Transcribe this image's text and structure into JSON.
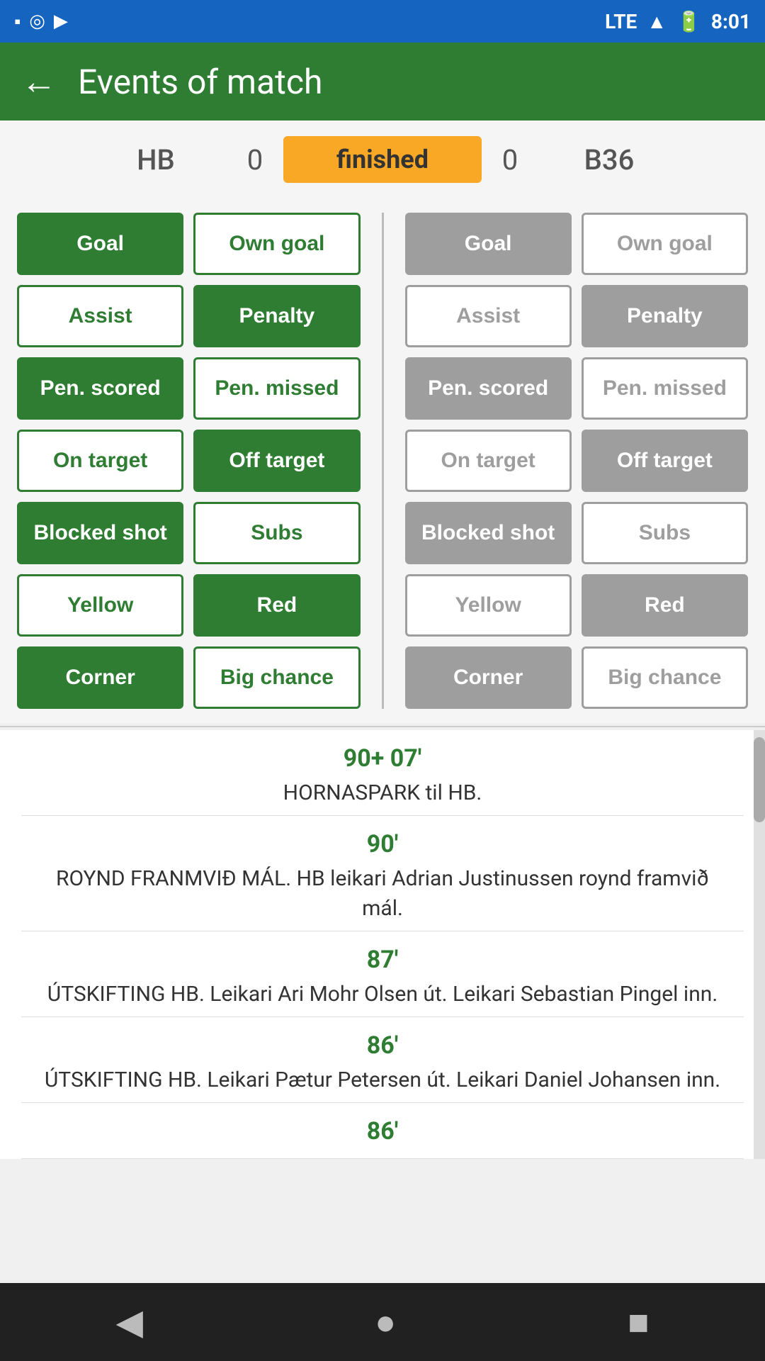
{
  "statusBar": {
    "time": "8:01",
    "icons": [
      "sd-icon",
      "signal-icon",
      "play-icon",
      "lte-icon",
      "battery-icon"
    ]
  },
  "header": {
    "backLabel": "←",
    "title": "Events of match"
  },
  "scoreRow": {
    "homeTeam": "HB",
    "homeScore": "0",
    "status": "finished",
    "awayScore": "0",
    "awayTeam": "B36"
  },
  "homeButtons": [
    {
      "label": "Goal",
      "style": "green-filled"
    },
    {
      "label": "Own goal",
      "style": "green-outline"
    },
    {
      "label": "Assist",
      "style": "green-outline"
    },
    {
      "label": "Penalty",
      "style": "green-filled"
    },
    {
      "label": "Pen. scored",
      "style": "green-filled"
    },
    {
      "label": "Pen. missed",
      "style": "green-outline"
    },
    {
      "label": "On target",
      "style": "green-outline"
    },
    {
      "label": "Off target",
      "style": "green-filled"
    },
    {
      "label": "Blocked shot",
      "style": "green-filled"
    },
    {
      "label": "Subs",
      "style": "green-outline"
    },
    {
      "label": "Yellow",
      "style": "green-outline"
    },
    {
      "label": "Red",
      "style": "green-filled"
    },
    {
      "label": "Corner",
      "style": "green-filled"
    },
    {
      "label": "Big chance",
      "style": "green-outline"
    }
  ],
  "awayButtons": [
    {
      "label": "Goal",
      "style": "gray-filled"
    },
    {
      "label": "Own goal",
      "style": "gray-outline"
    },
    {
      "label": "Assist",
      "style": "gray-outline"
    },
    {
      "label": "Penalty",
      "style": "gray-filled"
    },
    {
      "label": "Pen. scored",
      "style": "gray-filled"
    },
    {
      "label": "Pen. missed",
      "style": "gray-outline"
    },
    {
      "label": "On target",
      "style": "gray-outline"
    },
    {
      "label": "Off target",
      "style": "gray-filled"
    },
    {
      "label": "Blocked shot",
      "style": "gray-filled"
    },
    {
      "label": "Subs",
      "style": "gray-outline"
    },
    {
      "label": "Yellow",
      "style": "gray-outline"
    },
    {
      "label": "Red",
      "style": "gray-filled"
    },
    {
      "label": "Corner",
      "style": "gray-filled"
    },
    {
      "label": "Big chance",
      "style": "gray-outline"
    }
  ],
  "events": [
    {
      "time": "90+ 07'",
      "description": "HORNASPARK til HB."
    },
    {
      "time": "90'",
      "description": "ROYND FRANMVIÐ MÁL. HB leikari Adrian Justinussen roynd framvið mál."
    },
    {
      "time": "87'",
      "description": "ÚTSKIFTING HB. Leikari Ari Mohr Olsen út. Leikari Sebastian Pingel inn."
    },
    {
      "time": "86'",
      "description": "ÚTSKIFTING HB. Leikari Pætur Petersen út. Leikari Daniel Johansen inn."
    },
    {
      "time": "86'",
      "description": ""
    }
  ],
  "navBar": {
    "back": "◀",
    "home": "●",
    "recent": "■"
  }
}
